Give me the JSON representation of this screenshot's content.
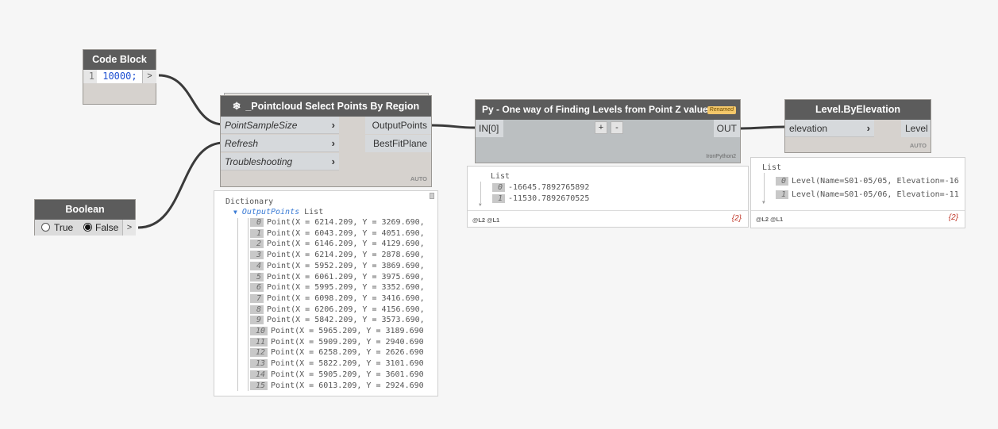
{
  "code_block": {
    "title": "Code Block",
    "line_number": "1",
    "code": "10000;",
    "output_arrow": ">"
  },
  "boolean_node": {
    "title": "Boolean",
    "true_label": "True",
    "false_label": "False",
    "output_arrow": ">"
  },
  "pointcloud_node": {
    "title": "_Pointcloud Select Points By Region",
    "inputs": [
      "PointSampleSize",
      "Refresh",
      "Troubleshooting"
    ],
    "outputs": [
      "OutputPoints",
      "BestFitPlane"
    ],
    "lacing": "AUTO",
    "preview": {
      "header": "Dictionary",
      "key_label": "OutputPoints",
      "key_type": "List",
      "items": [
        {
          "index": "0",
          "text": "Point(X = 6214.209, Y = 3269.690,"
        },
        {
          "index": "1",
          "text": "Point(X = 6043.209, Y = 4051.690,"
        },
        {
          "index": "2",
          "text": "Point(X = 6146.209, Y = 4129.690,"
        },
        {
          "index": "3",
          "text": "Point(X = 6214.209, Y = 2878.690,"
        },
        {
          "index": "4",
          "text": "Point(X = 5952.209, Y = 3869.690,"
        },
        {
          "index": "5",
          "text": "Point(X = 6061.209, Y = 3975.690,"
        },
        {
          "index": "6",
          "text": "Point(X = 5995.209, Y = 3352.690,"
        },
        {
          "index": "7",
          "text": "Point(X = 6098.209, Y = 3416.690,"
        },
        {
          "index": "8",
          "text": "Point(X = 6206.209, Y = 4156.690,"
        },
        {
          "index": "9",
          "text": "Point(X = 5842.209, Y = 3573.690,"
        },
        {
          "index": "10",
          "text": "Point(X = 5965.209, Y = 3189.690"
        },
        {
          "index": "11",
          "text": "Point(X = 5909.209, Y = 2940.690"
        },
        {
          "index": "12",
          "text": "Point(X = 6258.209, Y = 2626.690"
        },
        {
          "index": "13",
          "text": "Point(X = 5822.209, Y = 3101.690"
        },
        {
          "index": "14",
          "text": "Point(X = 5905.209, Y = 3601.690"
        },
        {
          "index": "15",
          "text": "Point(X = 6013.209, Y = 2924.690"
        }
      ]
    }
  },
  "python_node": {
    "title": "Py - One way of Finding Levels from Point Z values",
    "badge": "Renamed",
    "input": "IN[0]",
    "add_label": "+",
    "remove_label": "-",
    "output": "OUT",
    "engine": "IronPython2",
    "preview": {
      "header": "List",
      "items": [
        {
          "index": "0",
          "text": "-16645.7892765892"
        },
        {
          "index": "1",
          "text": "-11530.7892670525"
        }
      ],
      "levels": "@L2 @L1",
      "count": "{2}"
    }
  },
  "level_node": {
    "title": "Level.ByElevation",
    "input": "elevation",
    "output": "Level",
    "lacing": "AUTO",
    "preview": {
      "header": "List",
      "items": [
        {
          "index": "0",
          "text": "Level(Name=S01-05/05, Elevation=-16"
        },
        {
          "index": "1",
          "text": "Level(Name=S01-05/06, Elevation=-11"
        }
      ],
      "levels": "@L2 @L1",
      "count": "{2}"
    }
  },
  "colors": {
    "header": "#5c5c5c",
    "node_body": "#d6d2ce",
    "wire": "#3a3a3a",
    "badge": "#f3c76a",
    "code_number": "#1d4fd1"
  }
}
